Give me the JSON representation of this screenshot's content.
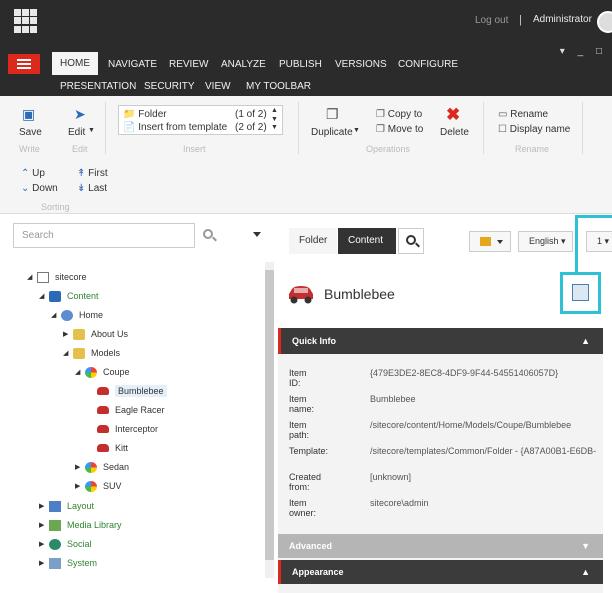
{
  "topbar": {
    "logout": "Log out",
    "separator": "|",
    "user": "Administrator"
  },
  "ribbon_tabs": [
    "HOME",
    "NAVIGATE",
    "REVIEW",
    "ANALYZE",
    "PUBLISH",
    "VERSIONS",
    "CONFIGURE"
  ],
  "ribbon_tabs_row2": [
    "PRESENTATION",
    "SECURITY",
    "VIEW",
    "MY TOOLBAR"
  ],
  "window_controls": [
    "▾",
    "_",
    "□"
  ],
  "ribbon": {
    "save": "Save",
    "edit": "Edit",
    "write_group": "Write",
    "edit_group": "Edit",
    "insert_options": [
      {
        "label": "Folder",
        "count": "(1 of 2)"
      },
      {
        "label": "Insert from template",
        "count": "(2 of 2)"
      }
    ],
    "insert_group": "Insert",
    "duplicate": "Duplicate",
    "copy_to": "Copy to",
    "move_to": "Move to",
    "delete": "Delete",
    "operations_group": "Operations",
    "rename": "Rename",
    "display_name": "Display name",
    "rename_group": "Rename",
    "up": "Up",
    "down": "Down",
    "first": "First",
    "last": "Last",
    "sorting_group": "Sorting"
  },
  "search": {
    "placeholder": "Search"
  },
  "tree": {
    "sitecore": "sitecore",
    "content": "Content",
    "home": "Home",
    "about_us": "About Us",
    "models": "Models",
    "coupe": "Coupe",
    "bumblebee": "Bumblebee",
    "eagle_racer": "Eagle Racer",
    "interceptor": "Interceptor",
    "kitt": "Kitt",
    "sedan": "Sedan",
    "suv": "SUV",
    "layout": "Layout",
    "media_library": "Media Library",
    "social": "Social",
    "system": "System"
  },
  "editor": {
    "tab_folder": "Folder",
    "tab_content": "Content",
    "language": "English",
    "version": "1",
    "title": "Bumblebee",
    "sections": {
      "quick_info": "Quick Info",
      "advanced": "Advanced",
      "appearance": "Appearance"
    },
    "fields": [
      {
        "label": "Item ID:",
        "value": "{479E3DE2-8EC8-4DF9-9F44-54551406057D}"
      },
      {
        "label": "Item name:",
        "value": "Bumblebee"
      },
      {
        "label": "Item path:",
        "value": "/sitecore/content/Home/Models/Coupe/Bumblebee"
      },
      {
        "label": "Template:",
        "value": "/sitecore/templates/Common/Folder - {A87A00B1-E6DB-"
      },
      {
        "label": "Created from:",
        "value": "[unknown]"
      },
      {
        "label": "Item owner:",
        "value": "sitecore\\admin"
      }
    ]
  },
  "colors": {
    "accent_red": "#dc291e",
    "highlight": "#2ec1d5",
    "dark_bar": "#2b2b2b"
  }
}
